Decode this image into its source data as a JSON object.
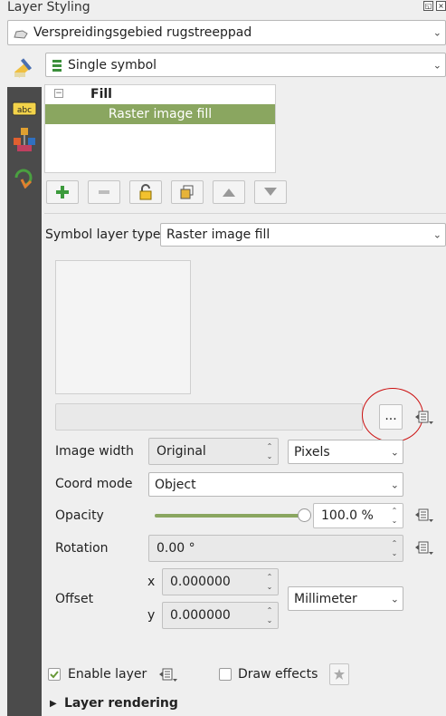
{
  "panel": {
    "title": "Layer Styling"
  },
  "layer_combo": {
    "value": "Verspreidingsgebied rugstreeppad"
  },
  "renderer_combo": {
    "value": "Single symbol"
  },
  "symbol_tree": {
    "root_label": "Fill",
    "collapse_glyph": "−",
    "selected_item": "Raster image fill"
  },
  "symbol_layer_type": {
    "label": "Symbol layer type",
    "value": "Raster image fill"
  },
  "file_picker": {
    "value": "",
    "browse_label": "..."
  },
  "image_width": {
    "label": "Image width",
    "value": "Original",
    "unit": "Pixels"
  },
  "coord_mode": {
    "label": "Coord mode",
    "value": "Object"
  },
  "opacity": {
    "label": "Opacity",
    "value": "100.0 %",
    "fraction": 1.0
  },
  "rotation": {
    "label": "Rotation",
    "value": "0.00 °"
  },
  "offset": {
    "label": "Offset",
    "x_label": "x",
    "x_value": "0.000000",
    "y_label": "y",
    "y_value": "0.000000",
    "unit": "Millimeter"
  },
  "enable_layer": {
    "label": "Enable layer",
    "checked": true
  },
  "draw_effects": {
    "label": "Draw effects",
    "checked": false
  },
  "layer_rendering": {
    "label": "Layer rendering"
  },
  "colors": {
    "selection": "#8aa660",
    "sidebar": "#4b4b4b",
    "annotation_circle": "#cc1111"
  }
}
